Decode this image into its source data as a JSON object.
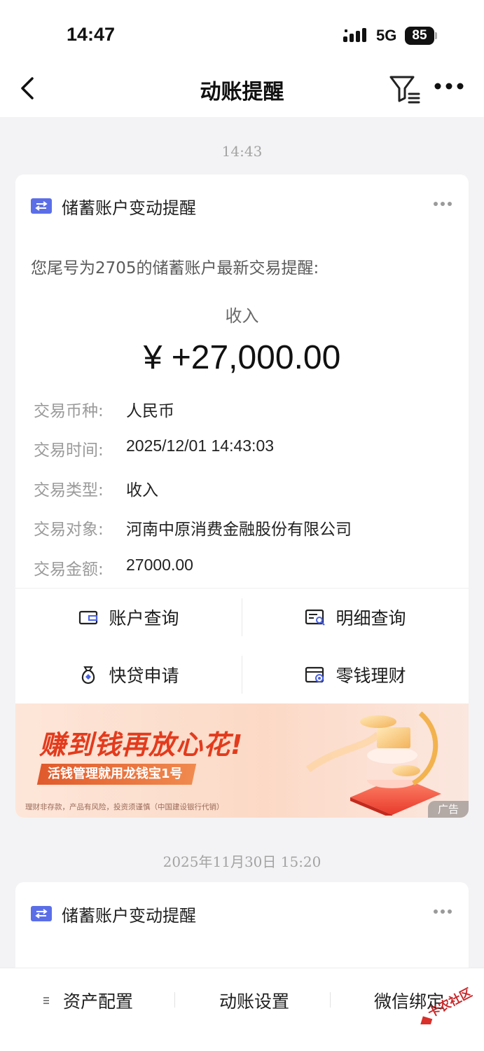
{
  "status": {
    "time": "14:47",
    "network": "5G",
    "battery": "85"
  },
  "nav": {
    "title": "动账提醒"
  },
  "timestamps": [
    "14:43",
    "2025年11月30日 15:20"
  ],
  "card1": {
    "title": "储蓄账户变动提醒",
    "intro": "您尾号为2705的储蓄账户最新交易提醒:",
    "amount_label": "收入",
    "amount": "¥ +27,000.00",
    "details": [
      {
        "label": "交易币种:",
        "value": "人民币"
      },
      {
        "label": "交易时间:",
        "value": "2025/12/01 14:43:03"
      },
      {
        "label": "交易类型:",
        "value": "收入"
      },
      {
        "label": "交易对象:",
        "value": "河南中原消费金融股份有限公司"
      },
      {
        "label": "交易金额:",
        "value": "27000.00"
      }
    ],
    "actions": [
      {
        "label": "账户查询",
        "icon": "wallet-icon"
      },
      {
        "label": "明细查询",
        "icon": "statement-search-icon"
      },
      {
        "label": "快贷申请",
        "icon": "loan-bag-icon"
      },
      {
        "label": "零钱理财",
        "icon": "wealth-card-icon"
      }
    ]
  },
  "ad": {
    "headline": "赚到钱再放心花!",
    "subline": "活钱管理就用龙钱宝1号",
    "disclaimer": "理财非存款，产品有风险，投资须谨慎（中国建设银行代销）",
    "tag": "广告"
  },
  "card2": {
    "title": "储蓄账户变动提醒"
  },
  "bottom_tabs": [
    {
      "label": "资产配置"
    },
    {
      "label": "动账设置"
    },
    {
      "label": "微信绑定"
    }
  ],
  "watermark": "卡农社区",
  "colors": {
    "accent": "#5b6ee8",
    "ad_red": "#e33b1d"
  }
}
